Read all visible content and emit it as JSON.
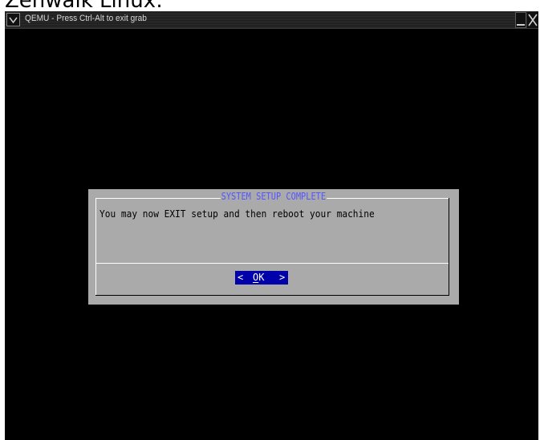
{
  "caption": "Zenwalk Linux:",
  "window": {
    "title": "QEMU - Press Ctrl-Alt to exit grab",
    "menu_icon": "chevron-down-icon",
    "minimize_icon": "minimize-icon",
    "close_icon": "close-icon"
  },
  "dialog": {
    "title": "SYSTEM SETUP COMPLETE",
    "message": "You may now EXIT setup and then reboot your machine",
    "ok_button": {
      "left_bracket": "<",
      "hotkey": "O",
      "rest": "K",
      "right_bracket": ">"
    }
  },
  "colors": {
    "screen_bg": "#000000",
    "dialog_bg": "#aaaaaa",
    "dialog_title": "#5555ff",
    "button_bg": "#0000aa",
    "button_text": "#ffffff"
  }
}
